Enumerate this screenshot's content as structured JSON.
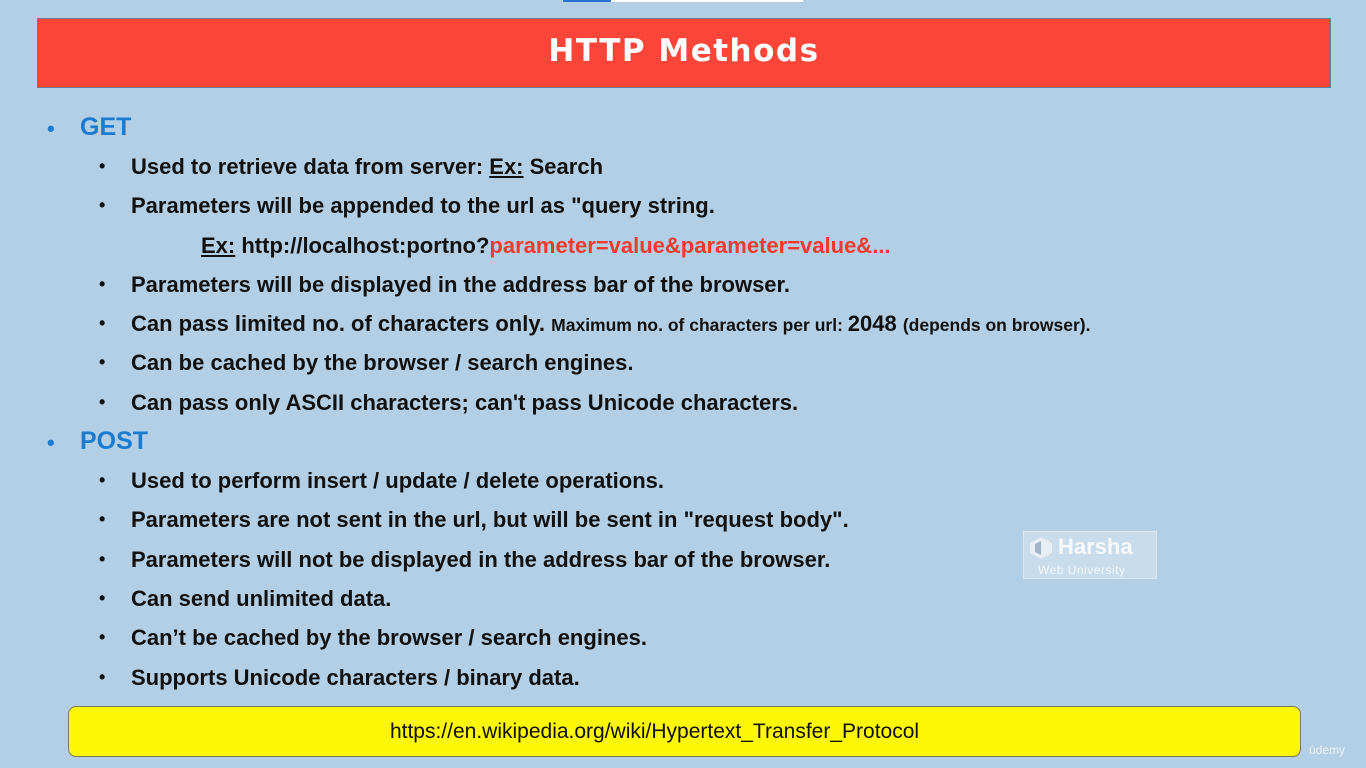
{
  "title": "HTTP Methods",
  "sections": [
    {
      "name": "GET",
      "items": [
        {
          "parts": [
            {
              "text": "Used to retrieve data from server: "
            },
            {
              "text": "Ex:",
              "underline": true
            },
            {
              "text": " Search"
            }
          ]
        },
        {
          "parts": [
            {
              "text": "Parameters will be appended to the url as \"query string."
            }
          ]
        },
        {
          "example": true,
          "parts": [
            {
              "text": "Ex:",
              "underline": true
            },
            {
              "text": " http://localhost:portno?"
            },
            {
              "text": "parameter=value&parameter=value&...",
              "color": "red"
            }
          ]
        },
        {
          "parts": [
            {
              "text": "Parameters will be displayed in the address bar of the browser."
            }
          ]
        },
        {
          "parts": [
            {
              "text": "Can pass limited no. of characters only. "
            },
            {
              "text": "Maximum no. of characters per url: ",
              "small": true
            },
            {
              "text": "2048 "
            },
            {
              "text": "(depends on browser).",
              "small": true
            }
          ]
        },
        {
          "parts": [
            {
              "text": "Can be cached by the browser / search engines."
            }
          ]
        },
        {
          "parts": [
            {
              "text": "Can pass only ASCII characters; can't pass Unicode characters."
            }
          ]
        }
      ]
    },
    {
      "name": "POST",
      "items": [
        {
          "parts": [
            {
              "text": "Used to perform insert / update / delete operations."
            }
          ]
        },
        {
          "parts": [
            {
              "text": "Parameters are not sent in the url, but will be sent in \"request body\"."
            }
          ]
        },
        {
          "parts": [
            {
              "text": "Parameters will not be displayed in the address bar of the browser."
            }
          ]
        },
        {
          "parts": [
            {
              "text": "Can send unlimited data."
            }
          ]
        },
        {
          "parts": [
            {
              "text": "Can’t be cached by the browser / search engines."
            }
          ]
        },
        {
          "parts": [
            {
              "text": "Supports Unicode characters / binary data."
            }
          ]
        }
      ]
    }
  ],
  "watermark": {
    "name": "Harsha",
    "subtitle": "Web University"
  },
  "link": "https://en.wikipedia.org/wiki/Hypertext_Transfer_Protocol",
  "brand": "ûdemy",
  "colors": {
    "background": "#b3cfe5",
    "title_bar": "#fb4539",
    "section_heading": "#1a7bd1",
    "highlight_text": "#ef3a2e",
    "link_bar": "#fcf607"
  },
  "icons": {
    "watermark_logo": "harsha-logo-icon"
  }
}
